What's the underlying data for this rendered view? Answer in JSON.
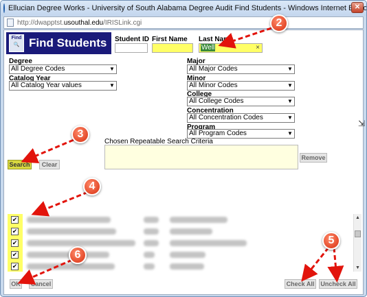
{
  "window": {
    "title": "Ellucian Degree Works - University of South Alabama Degree Audit Find Students - Windows Internet Explorer",
    "url_prefix": "http://dwapptst.",
    "url_domain": "usouthal.edu",
    "url_suffix": "/IRISLink.cgi",
    "close_glyph": "✕"
  },
  "logo": {
    "icon_text": "Find",
    "title": "Find Students"
  },
  "fields": {
    "student_id_label": "Student ID",
    "first_name_label": "First Name",
    "last_name_label": "Last Name",
    "last_name_value": "Well",
    "clear_glyph": "×"
  },
  "filters": {
    "degree": {
      "label": "Degree",
      "value": "All Degree Codes"
    },
    "catalog_year": {
      "label": "Catalog Year",
      "value": "All Catalog Year values"
    },
    "major": {
      "label": "Major",
      "value": "All Major Codes"
    },
    "minor": {
      "label": "Minor",
      "value": "All Minor Codes"
    },
    "college": {
      "label": "College",
      "value": "All College Codes"
    },
    "concentration": {
      "label": "Concentration",
      "value": "All Concentration Codes"
    },
    "program": {
      "label": "Program",
      "value": "All Program Codes"
    }
  },
  "chosen_label": "Chosen Repeatable Search Criteria",
  "buttons": {
    "search": "Search",
    "clear": "Clear",
    "remove": "Remove",
    "ok": "OK",
    "cancel": "Cancel",
    "check_all": "Check All",
    "uncheck_all": "Uncheck All"
  },
  "results": {
    "row_count": 5,
    "checked": "✔"
  },
  "markers": [
    "2",
    "3",
    "4",
    "5",
    "6"
  ],
  "colors": {
    "highlight": "#ffff66",
    "marker": "#d82e0f",
    "arrow": "#e2140c"
  }
}
